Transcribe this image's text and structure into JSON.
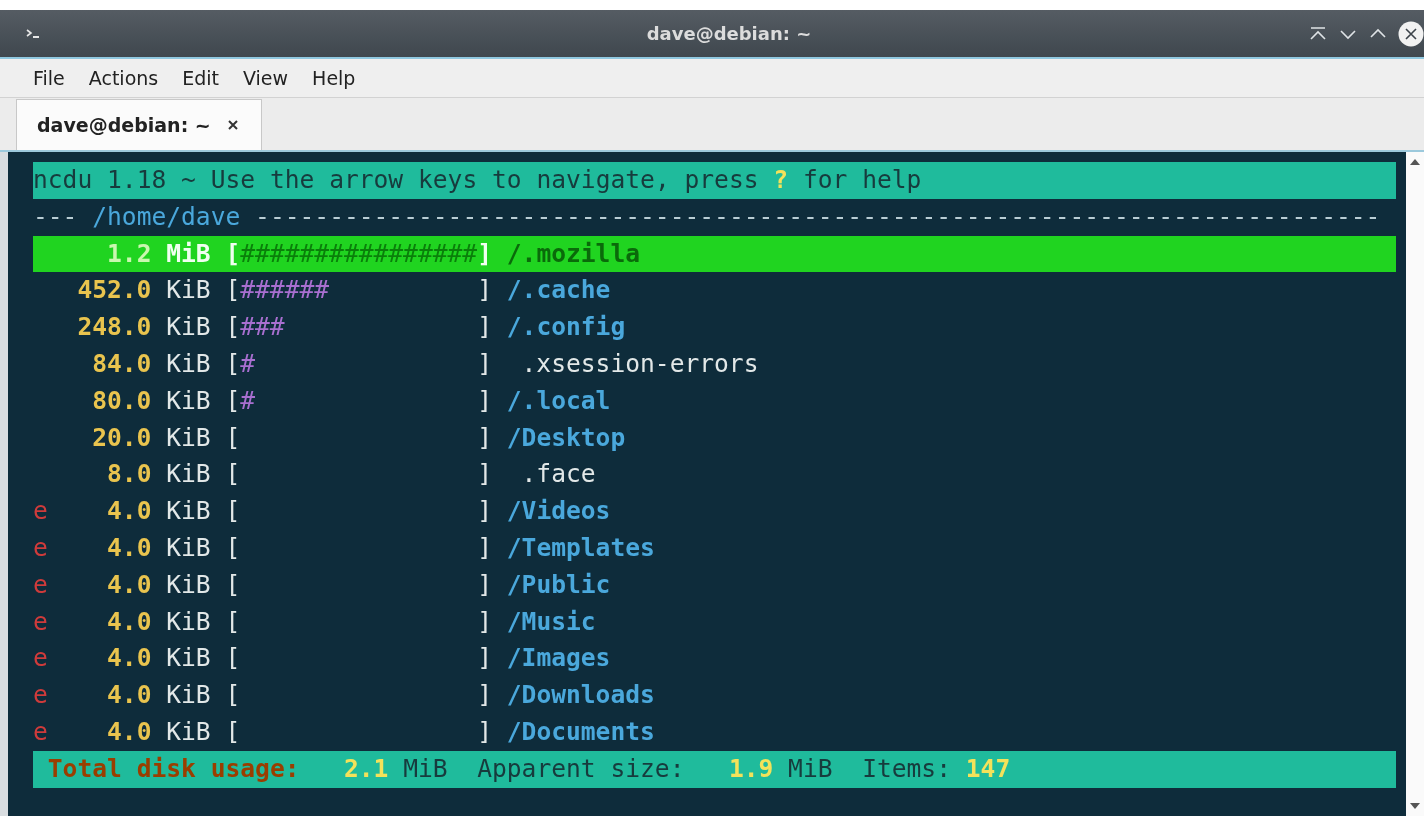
{
  "window": {
    "title": "dave@debian: ~"
  },
  "menu": [
    "File",
    "Actions",
    "Edit",
    "View",
    "Help"
  ],
  "tabs": [
    {
      "label": "dave@debian: ~",
      "selected": true
    }
  ],
  "terminal": {
    "header": {
      "before": "ncdu 1.18 ~ Use the arrow keys to navigate, press",
      "key": "?",
      "after": "for help"
    },
    "path": {
      "lead": "---",
      "dir": "/home/dave",
      "trail": "----------------------------------------------------------------------------"
    },
    "rows": [
      {
        "flag": "",
        "size": "1.2",
        "unit": "MiB",
        "open": "[",
        "hashes": "################",
        "close": "]",
        "name": "/.mozilla",
        "kind": "dir",
        "selected": true
      },
      {
        "flag": "",
        "size": "452.0",
        "unit": "KiB",
        "open": "[",
        "hashes": "######",
        "close": "]",
        "name": "/.cache",
        "kind": "dir",
        "selected": false
      },
      {
        "flag": "",
        "size": "248.0",
        "unit": "KiB",
        "open": "[",
        "hashes": "###",
        "close": "]",
        "name": "/.config",
        "kind": "dir",
        "selected": false
      },
      {
        "flag": "",
        "size": "84.0",
        "unit": "KiB",
        "open": "[",
        "hashes": "#",
        "close": "]",
        "name": ".xsession-errors",
        "kind": "file",
        "selected": false
      },
      {
        "flag": "",
        "size": "80.0",
        "unit": "KiB",
        "open": "[",
        "hashes": "#",
        "close": "]",
        "name": "/.local",
        "kind": "dir",
        "selected": false
      },
      {
        "flag": "",
        "size": "20.0",
        "unit": "KiB",
        "open": "[",
        "hashes": "",
        "close": "]",
        "name": "/Desktop",
        "kind": "dir",
        "selected": false
      },
      {
        "flag": "",
        "size": "8.0",
        "unit": "KiB",
        "open": "[",
        "hashes": "",
        "close": "]",
        "name": ".face",
        "kind": "file",
        "selected": false
      },
      {
        "flag": "e",
        "size": "4.0",
        "unit": "KiB",
        "open": "[",
        "hashes": "",
        "close": "]",
        "name": "/Videos",
        "kind": "dir",
        "selected": false
      },
      {
        "flag": "e",
        "size": "4.0",
        "unit": "KiB",
        "open": "[",
        "hashes": "",
        "close": "]",
        "name": "/Templates",
        "kind": "dir",
        "selected": false
      },
      {
        "flag": "e",
        "size": "4.0",
        "unit": "KiB",
        "open": "[",
        "hashes": "",
        "close": "]",
        "name": "/Public",
        "kind": "dir",
        "selected": false
      },
      {
        "flag": "e",
        "size": "4.0",
        "unit": "KiB",
        "open": "[",
        "hashes": "",
        "close": "]",
        "name": "/Music",
        "kind": "dir",
        "selected": false
      },
      {
        "flag": "e",
        "size": "4.0",
        "unit": "KiB",
        "open": "[",
        "hashes": "",
        "close": "]",
        "name": "/Images",
        "kind": "dir",
        "selected": false
      },
      {
        "flag": "e",
        "size": "4.0",
        "unit": "KiB",
        "open": "[",
        "hashes": "",
        "close": "]",
        "name": "/Downloads",
        "kind": "dir",
        "selected": false
      },
      {
        "flag": "e",
        "size": "4.0",
        "unit": "KiB",
        "open": "[",
        "hashes": "",
        "close": "]",
        "name": "/Documents",
        "kind": "dir",
        "selected": false
      }
    ],
    "footer": {
      "total_label": "Total disk usage:",
      "total_value": "2.1",
      "total_unit": "MiB",
      "apparent_label": "Apparent size:",
      "apparent_value": "1.9",
      "apparent_unit": "MiB",
      "items_label": "Items:",
      "items_value": "147"
    }
  }
}
